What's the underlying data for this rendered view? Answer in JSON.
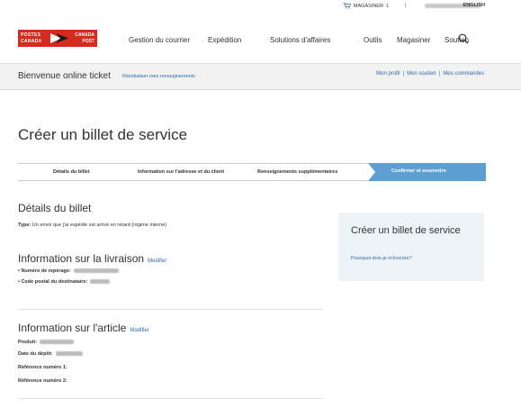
{
  "utility": {
    "cart_label": "MAGASINER",
    "cart_count": "1",
    "separator": "|",
    "language_link": "ENGLISH"
  },
  "header": {
    "logo": {
      "left_top": "POSTES",
      "left_bottom": "CANADA",
      "right_top": "CANADA",
      "right_bottom": "POST"
    },
    "nav": [
      {
        "label": "Gestion du courrier"
      },
      {
        "label": "Expédition"
      },
      {
        "label": "Solutions d'affaires"
      },
      {
        "label": "Outils"
      },
      {
        "label": "Magasiner"
      },
      {
        "label": "Soutien"
      }
    ],
    "nav_dot": "."
  },
  "welcome": {
    "greeting": "Bienvenue online ticket",
    "reset_link": "Réinitialiser mes renseignements",
    "links": [
      "Mon profil",
      "Mon soutien",
      "Mes commandes"
    ],
    "separator": "|"
  },
  "page_title": "Créer un billet de service",
  "steps": [
    {
      "label": "Détails du billet",
      "active": false
    },
    {
      "label": "Information sur l'adresse et du client",
      "active": false
    },
    {
      "label": "Renseignements supplémentaires",
      "active": false
    },
    {
      "label": "Confirmer et soumettre",
      "active": true
    }
  ],
  "ticket_details": {
    "heading": "Détails du billet",
    "type_label": "Type:",
    "type_value": "Un envoi que j'ai expédié est arrivé en retard (régime interne)"
  },
  "delivery": {
    "heading": "Information sur la livraison",
    "modify": "Modifier",
    "tracking_label": "• Numéro de repérage:",
    "postal_label": "• Code postal du destinataire:"
  },
  "article": {
    "heading": "Information sur l'article",
    "modify": "Modifier",
    "product_label": "Produit:",
    "deposit_label": "Date du dépôt:",
    "ref1_label": "Référence numéro 1:",
    "ref2_label": "Référence numéro 2:"
  },
  "sidebar": {
    "title": "Créer un billet de service",
    "link": "Pourquoi dois-je m'inscrire?"
  },
  "colors": {
    "brand_red": "#d52b1e",
    "link_blue": "#2c6ba8",
    "active_step": "#5c9fd0",
    "sidebar_bg": "#eef3f8"
  }
}
